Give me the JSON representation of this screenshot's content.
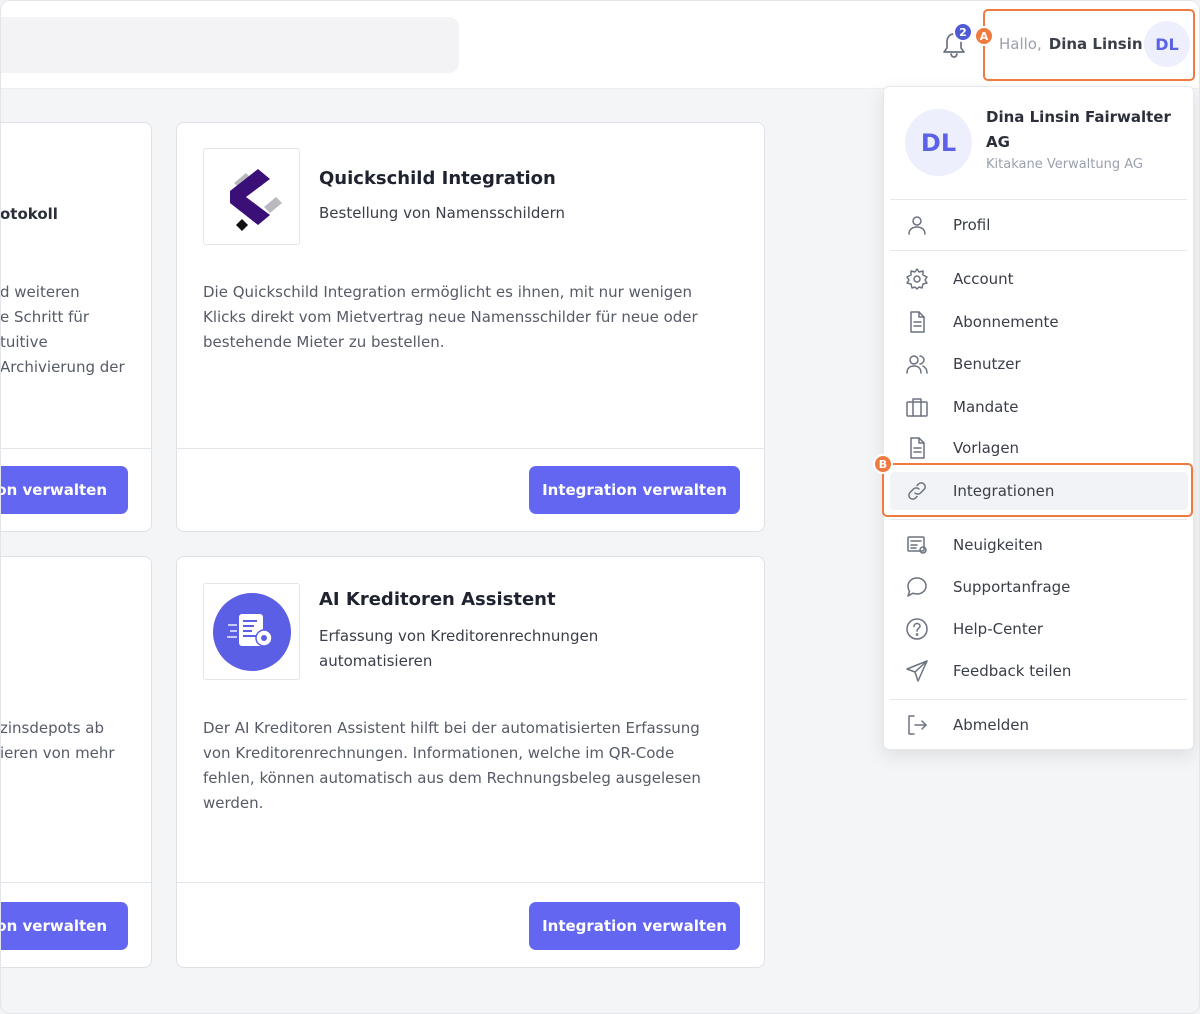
{
  "topbar": {
    "notification_count": "2",
    "greeting": "Hallo,",
    "user_name": "Dina Linsin",
    "avatar_initials": "DL",
    "highlight_tag": "A"
  },
  "cards": [
    {
      "title": "",
      "subtitle": "otokoll",
      "description_lines": [
        "d weiteren",
        "e Schritt für",
        "tuitive",
        "Archivierung der"
      ],
      "button_label": "ion verwalten"
    },
    {
      "title": "Quickschild Integration",
      "subtitle": "Bestellung von Namensschildern",
      "description_lines": [
        "Die Quickschild Integration ermöglicht es ihnen, mit nur wenigen",
        "Klicks direkt vom Mietvertrag neue Namensschilder für neue oder",
        "bestehende Mieter zu bestellen."
      ],
      "button_label": "Integration verwalten"
    },
    {
      "title": "",
      "subtitle": "",
      "description_lines": [
        "zinsdepots ab",
        "ieren von mehr"
      ],
      "button_label": "ion verwalten"
    },
    {
      "title": "AI Kreditoren Assistent",
      "subtitle_lines": [
        "Erfassung von Kreditorenrechnungen",
        "automatisieren"
      ],
      "description_lines": [
        "Der AI Kreditoren Assistent hilft bei der automatisierten Erfassung",
        "von Kreditorenrechnungen. Informationen, welche im QR-Code",
        "fehlen, können automatisch aus dem Rechnungsbeleg ausgelesen",
        "werden."
      ],
      "button_label": "Integration verwalten"
    }
  ],
  "menu": {
    "avatar_initials": "DL",
    "org_name": "Dina Linsin Fairwalter AG",
    "company": "Kitakane Verwaltung AG",
    "items": [
      {
        "label": "Profil",
        "icon": "user-icon"
      },
      {
        "label": "Account",
        "icon": "gear-icon"
      },
      {
        "label": "Abonnemente",
        "icon": "document-icon"
      },
      {
        "label": "Benutzer",
        "icon": "users-icon"
      },
      {
        "label": "Mandate",
        "icon": "briefcase-icon"
      },
      {
        "label": "Vorlagen",
        "icon": "document-icon"
      },
      {
        "label": "Integrationen",
        "icon": "link-icon"
      },
      {
        "label": "Neuigkeiten",
        "icon": "news-icon"
      },
      {
        "label": "Supportanfrage",
        "icon": "chat-bubble-icon"
      },
      {
        "label": "Help-Center",
        "icon": "question-circle-icon"
      },
      {
        "label": "Feedback teilen",
        "icon": "send-icon"
      },
      {
        "label": "Abmelden",
        "icon": "logout-icon"
      }
    ],
    "highlight_tag": "B"
  },
  "colors": {
    "accent": "#6366f1",
    "highlight": "#f07a3f",
    "avatar_bg": "#eeeffd"
  }
}
